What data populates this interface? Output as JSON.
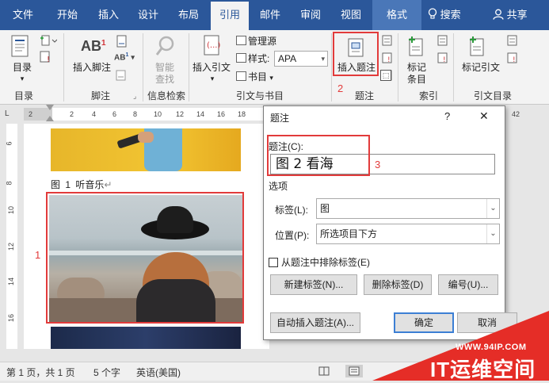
{
  "tabs": {
    "file": "文件",
    "home": "开始",
    "insert": "插入",
    "design": "设计",
    "layout": "布局",
    "references": "引用",
    "mailings": "邮件",
    "review": "审阅",
    "view": "视图",
    "format": "格式",
    "search": "搜索",
    "share": "共享"
  },
  "ribbon": {
    "toc": {
      "btn": "目录",
      "group": "目录"
    },
    "footnotes": {
      "btn": "插入脚注",
      "ab": "AB",
      "sup": "1",
      "ab2": "AB",
      "group": "脚注"
    },
    "research": {
      "btn1": "智能",
      "btn2": "查找",
      "group": "信息检索"
    },
    "citations": {
      "btn": "插入引文",
      "manage": "管理源",
      "style_label": "样式:",
      "style_value": "APA",
      "biblio": "书目",
      "group": "引文与书目"
    },
    "captions": {
      "btn": "插入题注",
      "group": "题注"
    },
    "index": {
      "btn1": "标记",
      "btn2": "条目",
      "group": "索引"
    },
    "toa": {
      "btn": "标记引文",
      "group": "引文目录"
    }
  },
  "ruler": {
    "h": [
      "2",
      "2",
      "4",
      "6",
      "8",
      "10",
      "12",
      "14",
      "16",
      "18",
      "42"
    ],
    "v": [
      "6",
      "8",
      "10",
      "12",
      "14",
      "16"
    ],
    "corner": "L"
  },
  "document": {
    "caption_prefix": "图",
    "caption_num": "1",
    "caption_text": "听音乐",
    "para_mark": "↵"
  },
  "dialog": {
    "title": "题注",
    "help": "?",
    "close": "✕",
    "caption_label": "题注(C):",
    "caption_value": "图 2 看海",
    "options_heading": "选项",
    "label_label": "标签(L):",
    "label_value": "图",
    "position_label": "位置(P):",
    "position_value": "所选项目下方",
    "exclude_label": "从题注中排除标签(E)",
    "new_label_btn": "新建标签(N)...",
    "delete_label_btn": "删除标签(D)",
    "numbering_btn": "编号(U)...",
    "autocaption_btn": "自动插入题注(A)...",
    "ok_btn": "确定",
    "cancel_btn": "取消"
  },
  "annotations": {
    "n1": "1",
    "n2": "2",
    "n3": "3"
  },
  "status": {
    "page": "第 1 页，共 1 页",
    "words": "5 个字",
    "lang": "英语(美国)"
  },
  "watermark": {
    "url": "WWW.94IP.COM",
    "brand": "IT运维空间"
  },
  "colors": {
    "word_blue": "#2b579a",
    "annotation_red": "#e23b3b",
    "watermark_red": "#e52d27"
  }
}
